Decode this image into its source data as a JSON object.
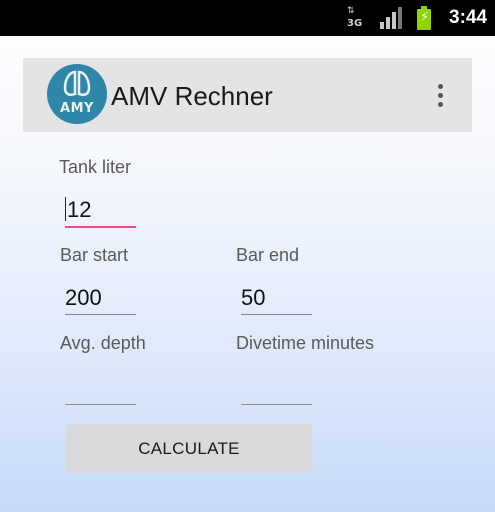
{
  "status_bar": {
    "network_type": "3G",
    "time": "3:44"
  },
  "app_bar": {
    "logo_text": "AMY",
    "title": "AMV Rechner",
    "overflow_icon": "more-vert-icon"
  },
  "form": {
    "tank_liter": {
      "label": "Tank liter",
      "value": "12"
    },
    "bar_start": {
      "label": "Bar start",
      "value": "200"
    },
    "bar_end": {
      "label": "Bar end",
      "value": "50"
    },
    "avg_depth": {
      "label": "Avg. depth",
      "value": ""
    },
    "divetime": {
      "label": "Divetime minutes",
      "value": ""
    },
    "calculate_label": "CALCULATE"
  },
  "colors": {
    "status_bar": "#000000",
    "battery": "#8fd400",
    "action_bar": "#e4e4e4",
    "logo": "#2f86a9",
    "focus_underline": "#e84e7f",
    "button": "#d9d9d9"
  }
}
